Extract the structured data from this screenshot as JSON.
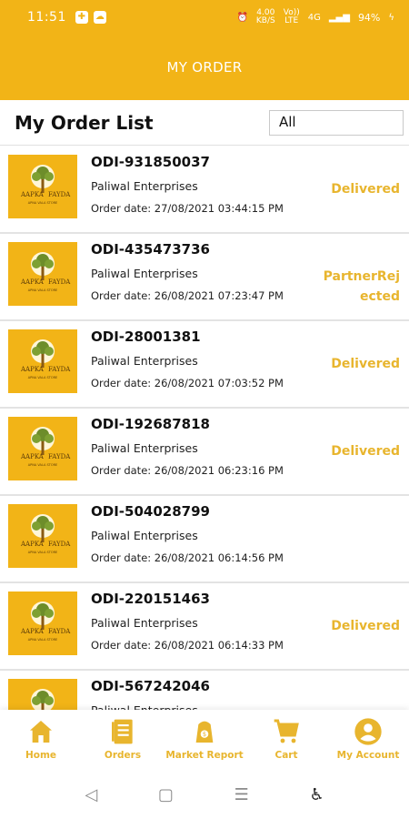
{
  "status_bar": {
    "time": "11:51",
    "network_speed": "4.00\nKB/S",
    "lte": "Vo))\nLTE",
    "signal": "4G",
    "battery": "94%"
  },
  "app_bar": {
    "title": "MY ORDER"
  },
  "list_header": {
    "title": "My Order List",
    "filter_value": "All"
  },
  "orders": [
    {
      "id": "ODI-931850037",
      "vendor": "Paliwal Enterprises",
      "date": "Order date: 27/08/2021 03:44:15 PM",
      "status": "Delivered"
    },
    {
      "id": "ODI-435473736",
      "vendor": "Paliwal Enterprises",
      "date": "Order date: 26/08/2021 07:23:47 PM",
      "status": "PartnerRejected"
    },
    {
      "id": "ODI-28001381",
      "vendor": "Paliwal Enterprises",
      "date": "Order date: 26/08/2021 07:03:52 PM",
      "status": "Delivered"
    },
    {
      "id": "ODI-192687818",
      "vendor": "Paliwal Enterprises",
      "date": "Order date: 26/08/2021 06:23:16 PM",
      "status": "Delivered"
    },
    {
      "id": "ODI-504028799",
      "vendor": "Paliwal Enterprises",
      "date": "Order date: 26/08/2021 06:14:56 PM",
      "status": ""
    },
    {
      "id": "ODI-220151463",
      "vendor": "Paliwal Enterprises",
      "date": "Order date: 26/08/2021 06:14:33 PM",
      "status": "Delivered"
    },
    {
      "id": "ODI-567242046",
      "vendor": "Paliwal Enterprises",
      "date": "",
      "status": ""
    }
  ],
  "thumbnail_logo": {
    "line1": "AAPKA",
    "line2": "FAYDA",
    "tagline": "APNA VALA STORE"
  },
  "bottom_nav": [
    {
      "label": "Home",
      "icon": "home-icon"
    },
    {
      "label": "Orders",
      "icon": "orders-icon"
    },
    {
      "label": "Market Report",
      "icon": "market-report-icon"
    },
    {
      "label": "Cart",
      "icon": "cart-icon"
    },
    {
      "label": "My Account",
      "icon": "account-icon"
    }
  ],
  "colors": {
    "primary": "#f2b417",
    "status_text": "#e8b52e",
    "white": "#ffffff"
  }
}
